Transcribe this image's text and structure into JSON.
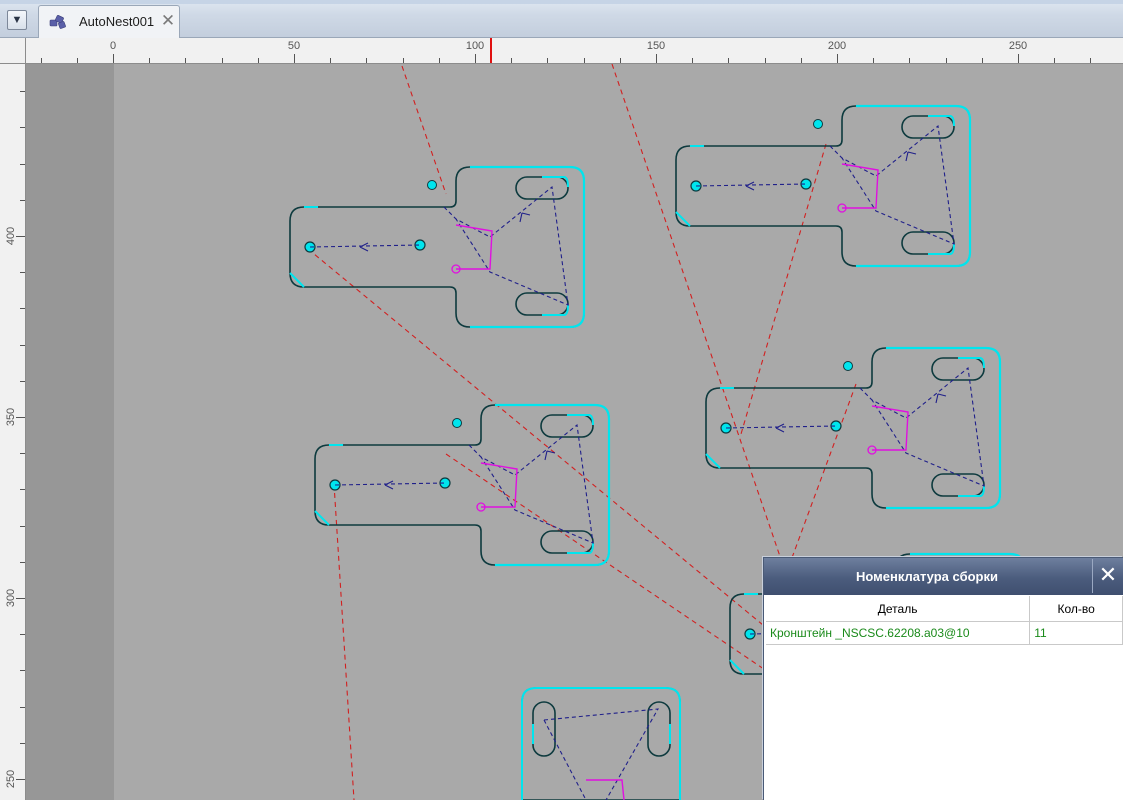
{
  "tab": {
    "title": "AutoNest001",
    "icon": "nest-parts-icon",
    "close_icon": "close-icon"
  },
  "window": {
    "menu_icon": "dropdown-arrow-icon"
  },
  "ruler_h": {
    "labels": [
      "0",
      "50",
      "100",
      "150",
      "200",
      "250"
    ]
  },
  "ruler_v": {
    "labels": [
      "400",
      "350",
      "300",
      "250"
    ]
  },
  "panel": {
    "title": "Номенклатура сборки",
    "close_icon": "close-icon",
    "columns": {
      "part": "Деталь",
      "qty": "Кол-во"
    },
    "rows": [
      {
        "part": "Кронштейн _NSCSC.62208.a03@10",
        "qty": "11"
      }
    ]
  },
  "colors": {
    "sheet": "#a9a9a9",
    "margin": "#979797",
    "part_outline": "#0d3a3e",
    "cut_highlight": "#00e5ee",
    "rapid_move": "#d22020",
    "toolpath": "#20208a",
    "lead_in": "#e010e0",
    "ruler_marker": "#e01010",
    "panel_header": "#4b5c7d",
    "row_text": "#1a8a1a"
  }
}
